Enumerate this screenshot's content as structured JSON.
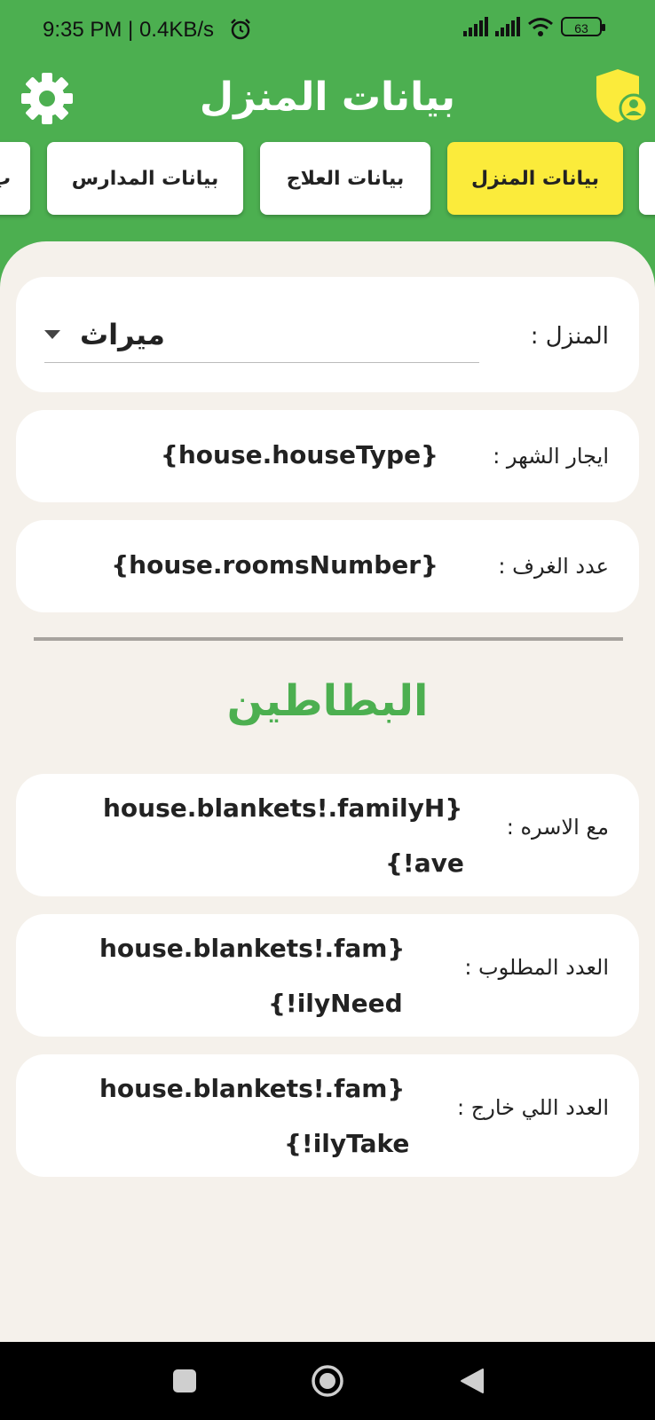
{
  "status_bar": {
    "time_speed": "9:35 PM | 0.4KB/s",
    "battery": "63"
  },
  "app_bar": {
    "title": "بيانات المنزل"
  },
  "tabs": [
    {
      "label": "بيانات المنزل",
      "active": true
    },
    {
      "label": "بيانات العلاج",
      "active": false
    },
    {
      "label": "بيانات المدارس",
      "active": false
    },
    {
      "label": "ب",
      "active": false
    }
  ],
  "house": {
    "label": "المنزل :",
    "selected": "ميراث"
  },
  "rent": {
    "label": "ايجار الشهر :",
    "value": "{house.houseType}"
  },
  "rooms": {
    "label": "عدد الغرف :",
    "value": "{house.roomsNumber}"
  },
  "blankets": {
    "title": "البطاطين",
    "with_family": {
      "label": "مع الاسره :",
      "line1": "house.blankets!.familyH}",
      "line2": "{!ave"
    },
    "needed": {
      "label": "العدد المطلوب :",
      "line1": "house.blankets!.fam}",
      "line2": "{!ilyNeed"
    },
    "taken_out": {
      "label": "العدد اللي خارج :",
      "line1": "house.blankets!.fam}",
      "line2": "{!ilyTake"
    }
  },
  "colors": {
    "primary": "#4caf50",
    "active_tab": "#fbeb3b",
    "background": "#f5f1eb"
  }
}
